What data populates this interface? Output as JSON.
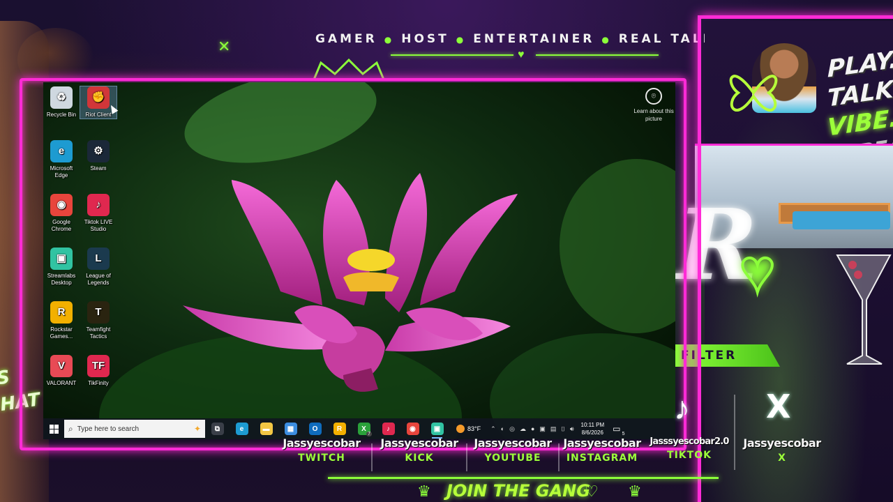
{
  "overlay": {
    "tagline": [
      "GAMER",
      "HOST",
      "ENTERTAINER",
      "REAL TALK"
    ],
    "slogan": [
      "PLAY.",
      "TALK.",
      "VIBE.",
      "REPEA"
    ],
    "filter_label": "FILTER",
    "join_label": "JOIN THE GANG",
    "side_text": [
      "S",
      "HAT"
    ],
    "accent_pink": "#ff2bd6",
    "accent_green": "#8cff3a",
    "socials": [
      {
        "handle": "Jassyescobar",
        "platform": "TWITCH"
      },
      {
        "handle": "Jassyescobar",
        "platform": "KICK"
      },
      {
        "handle": "Jassyescobar",
        "platform": "YOUTUBE"
      },
      {
        "handle": "Jassyescobar",
        "platform": "INSTAGRAM"
      },
      {
        "handle": "Jasssyescobar2.0",
        "platform": "TIKTOK"
      },
      {
        "handle": "Jassyescobar",
        "platform": "X"
      }
    ]
  },
  "desktop": {
    "icons": [
      {
        "label": "Recycle Bin",
        "icon": "recycle-bin-icon",
        "color": "#cfd8e0",
        "glyph": "♻"
      },
      {
        "label": "Riot Client",
        "icon": "riot-client-icon",
        "color": "#d13639",
        "glyph": "✊",
        "selected": true
      },
      {
        "label": "Microsoft Edge",
        "icon": "edge-icon",
        "color": "#1d9bd1",
        "glyph": "e"
      },
      {
        "label": "Steam",
        "icon": "steam-icon",
        "color": "#1b2838",
        "glyph": "⚙"
      },
      {
        "label": "Google Chrome",
        "icon": "chrome-icon",
        "color": "#e8453c",
        "glyph": "◉"
      },
      {
        "label": "Tiktok LIVE Studio",
        "icon": "tiktok-live-studio-icon",
        "color": "#e0284f",
        "glyph": "♪"
      },
      {
        "label": "Streamlabs Desktop",
        "icon": "streamlabs-icon",
        "color": "#31c3a2",
        "glyph": "▣"
      },
      {
        "label": "League of Legends",
        "icon": "league-of-legends-icon",
        "color": "#1b3a4e",
        "glyph": "L"
      },
      {
        "label": "Rockstar Games...",
        "icon": "rockstar-games-icon",
        "color": "#f2b000",
        "glyph": "R"
      },
      {
        "label": "Teamfight Tactics",
        "icon": "teamfight-tactics-icon",
        "color": "#2a2410",
        "glyph": "T"
      },
      {
        "label": "VALORANT",
        "icon": "valorant-icon",
        "color": "#e84a55",
        "glyph": "V"
      },
      {
        "label": "TikFinity",
        "icon": "tikfinity-icon",
        "color": "#e0284f",
        "glyph": "TF"
      }
    ],
    "learn_picture": "Learn about this picture"
  },
  "taskbar": {
    "search_placeholder": "Type here to search",
    "apps": [
      {
        "icon": "task-view-icon",
        "color": "#3a3f48",
        "glyph": "⧉"
      },
      {
        "icon": "edge-taskbar-icon",
        "color": "#1d9bd1",
        "glyph": "e"
      },
      {
        "icon": "file-explorer-icon",
        "color": "#f2c744",
        "glyph": "▬"
      },
      {
        "icon": "microsoft-store-icon",
        "color": "#3c8de0",
        "glyph": "▦"
      },
      {
        "icon": "outlook-icon",
        "color": "#0f6cbd",
        "glyph": "O"
      },
      {
        "icon": "rockstar-taskbar-icon",
        "color": "#f2b000",
        "glyph": "R"
      },
      {
        "icon": "xbox-icon",
        "color": "#2aa13a",
        "glyph": "X",
        "badge": "7"
      },
      {
        "icon": "tiktok-taskbar-icon",
        "color": "#e0284f",
        "glyph": "♪"
      },
      {
        "icon": "chrome-taskbar-icon",
        "color": "#e8453c",
        "glyph": "◉"
      },
      {
        "icon": "streamlabs-taskbar-icon",
        "color": "#31c3a2",
        "glyph": "▣",
        "active": true
      }
    ],
    "temperature": "83°F",
    "time": "10:11 PM",
    "date": "8/6/2026",
    "notification_count": "5"
  }
}
